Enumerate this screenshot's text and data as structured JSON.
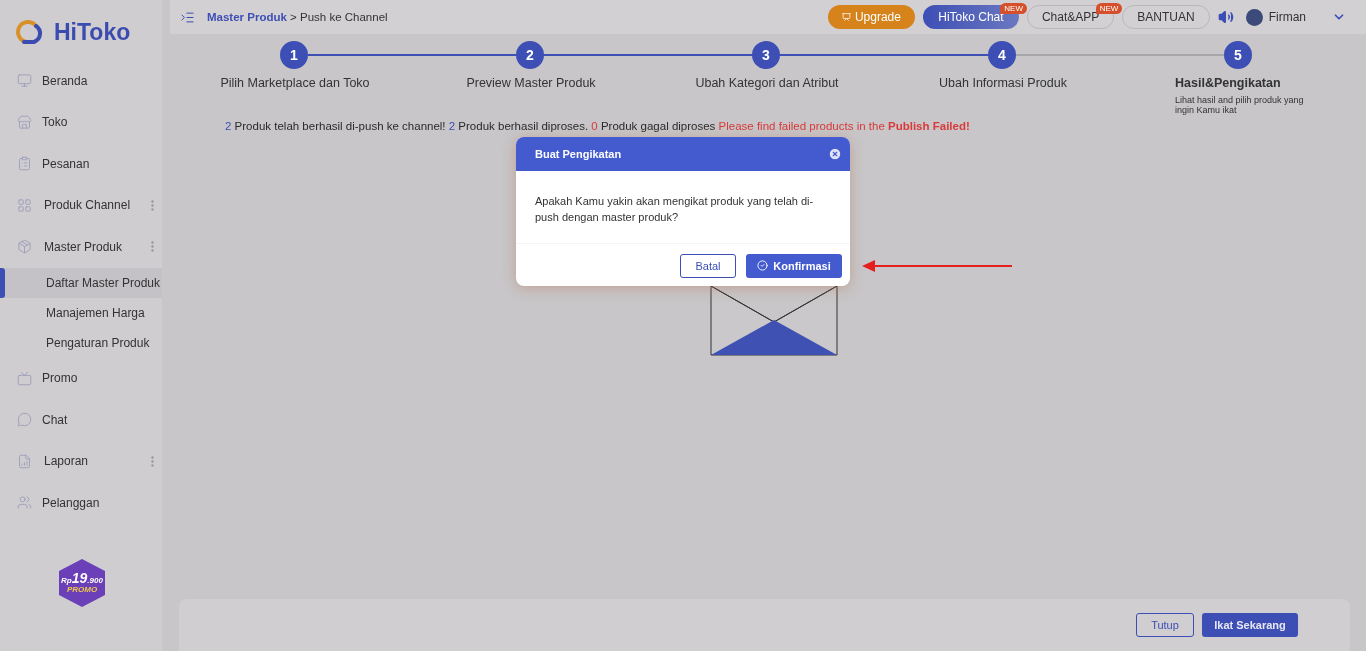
{
  "brand": {
    "name": "HiToko"
  },
  "sidebar": {
    "items": [
      {
        "label": "Beranda",
        "expandable": false
      },
      {
        "label": "Toko",
        "expandable": false
      },
      {
        "label": "Pesanan",
        "expandable": false
      },
      {
        "label": "Produk Channel",
        "expandable": true
      },
      {
        "label": "Master Produk",
        "expandable": true,
        "children": [
          {
            "label": "Daftar Master Produk",
            "selected": true
          },
          {
            "label": "Manajemen Harga",
            "selected": false
          },
          {
            "label": "Pengaturan Produk",
            "selected": false
          }
        ]
      },
      {
        "label": "Promo",
        "expandable": false
      },
      {
        "label": "Chat",
        "expandable": false
      },
      {
        "label": "Laporan",
        "expandable": true
      },
      {
        "label": "Pelanggan",
        "expandable": false
      }
    ]
  },
  "promo_badge": {
    "currency": "Rp",
    "amount": "19",
    "decimals": ".900",
    "label": "PROMO"
  },
  "breadcrumb": {
    "parent": "Master Produk",
    "separator": ">",
    "current": "Push ke Channel"
  },
  "header_buttons": [
    {
      "kind": "upgrade",
      "label": "Upgrade"
    },
    {
      "kind": "primary",
      "label": "HiToko Chat",
      "badge": "NEW"
    },
    {
      "kind": "outline",
      "label": "Chat&APP",
      "badge": "NEW"
    },
    {
      "kind": "outline",
      "label": "BANTUAN"
    }
  ],
  "user": {
    "name": "Firman"
  },
  "step_progress": {
    "level": 0.75
  },
  "steps": [
    {
      "number": "1",
      "label": "Pilih Marketplace dan Toko",
      "selected": false
    },
    {
      "number": "2",
      "label": "Preview Master Produk",
      "selected": false
    },
    {
      "number": "3",
      "label": "Ubah Kategori dan Atribut",
      "selected": false
    },
    {
      "number": "4",
      "label": "Ubah Informasi Produk",
      "selected": false
    },
    {
      "number": "5",
      "label": "Hasil&Pengikatan",
      "subtitle": "Lihat hasil and pilih produk yang ingin Kamu ikat",
      "selected": true
    }
  ],
  "result_message": [
    {
      "kind": "count",
      "text": "2"
    },
    {
      "kind": "plain",
      "text": " Produk telah berhasil di-push ke channel! "
    },
    {
      "kind": "count",
      "text": "2"
    },
    {
      "kind": "plain",
      "text": " Produk berhasil diproses. "
    },
    {
      "kind": "error",
      "text": "0"
    },
    {
      "kind": "plain",
      "text": " Produk gagal diproses "
    },
    {
      "kind": "error",
      "text": "Please find failed products in the "
    },
    {
      "kind": "strong",
      "text": "Publish Failed!"
    }
  ],
  "dialog": {
    "title": "Buat Pengikatan",
    "message": "Apakah Kamu yakin akan mengikat produk yang telah di-push dengan master produk?",
    "cancel": "Batal",
    "confirm": "Konfirmasi"
  },
  "footer_buttons": [
    {
      "kind": "outline",
      "label": "Tutup"
    },
    {
      "kind": "primary",
      "label": "Ikat Sekarang"
    }
  ]
}
